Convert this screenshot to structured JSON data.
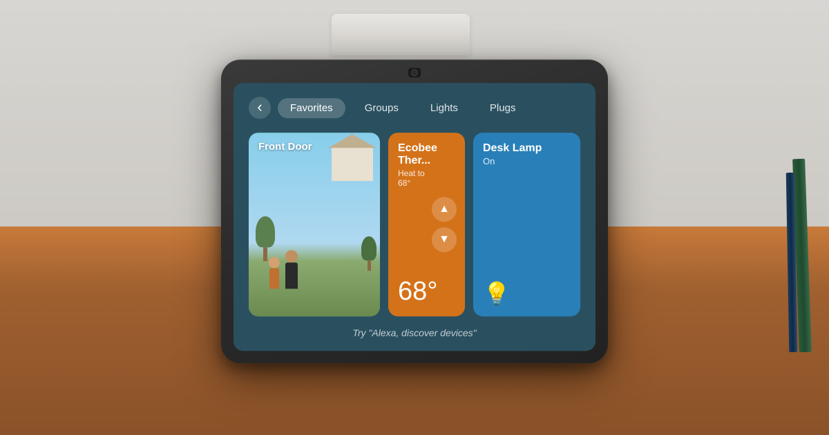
{
  "room": {
    "bg_top": "#d6d4d0",
    "bg_bottom": "#a07850"
  },
  "device": {
    "camera_label": "camera"
  },
  "nav": {
    "back_label": "‹",
    "tabs": [
      {
        "label": "Favorites",
        "active": true
      },
      {
        "label": "Groups",
        "active": false
      },
      {
        "label": "Lights",
        "active": false
      },
      {
        "label": "Plugs",
        "active": false
      }
    ]
  },
  "cards": {
    "frontdoor": {
      "title": "Front Door"
    },
    "thermostat": {
      "title": "Ecobee Ther...",
      "subtitle": "Heat to",
      "setpoint": "68°",
      "current_temp": "68°",
      "up_label": "▲",
      "down_label": "▼"
    },
    "lamp": {
      "title": "Desk Lamp",
      "status": "On"
    }
  },
  "hint": {
    "text": "Try \"Alexa, discover devices\""
  }
}
